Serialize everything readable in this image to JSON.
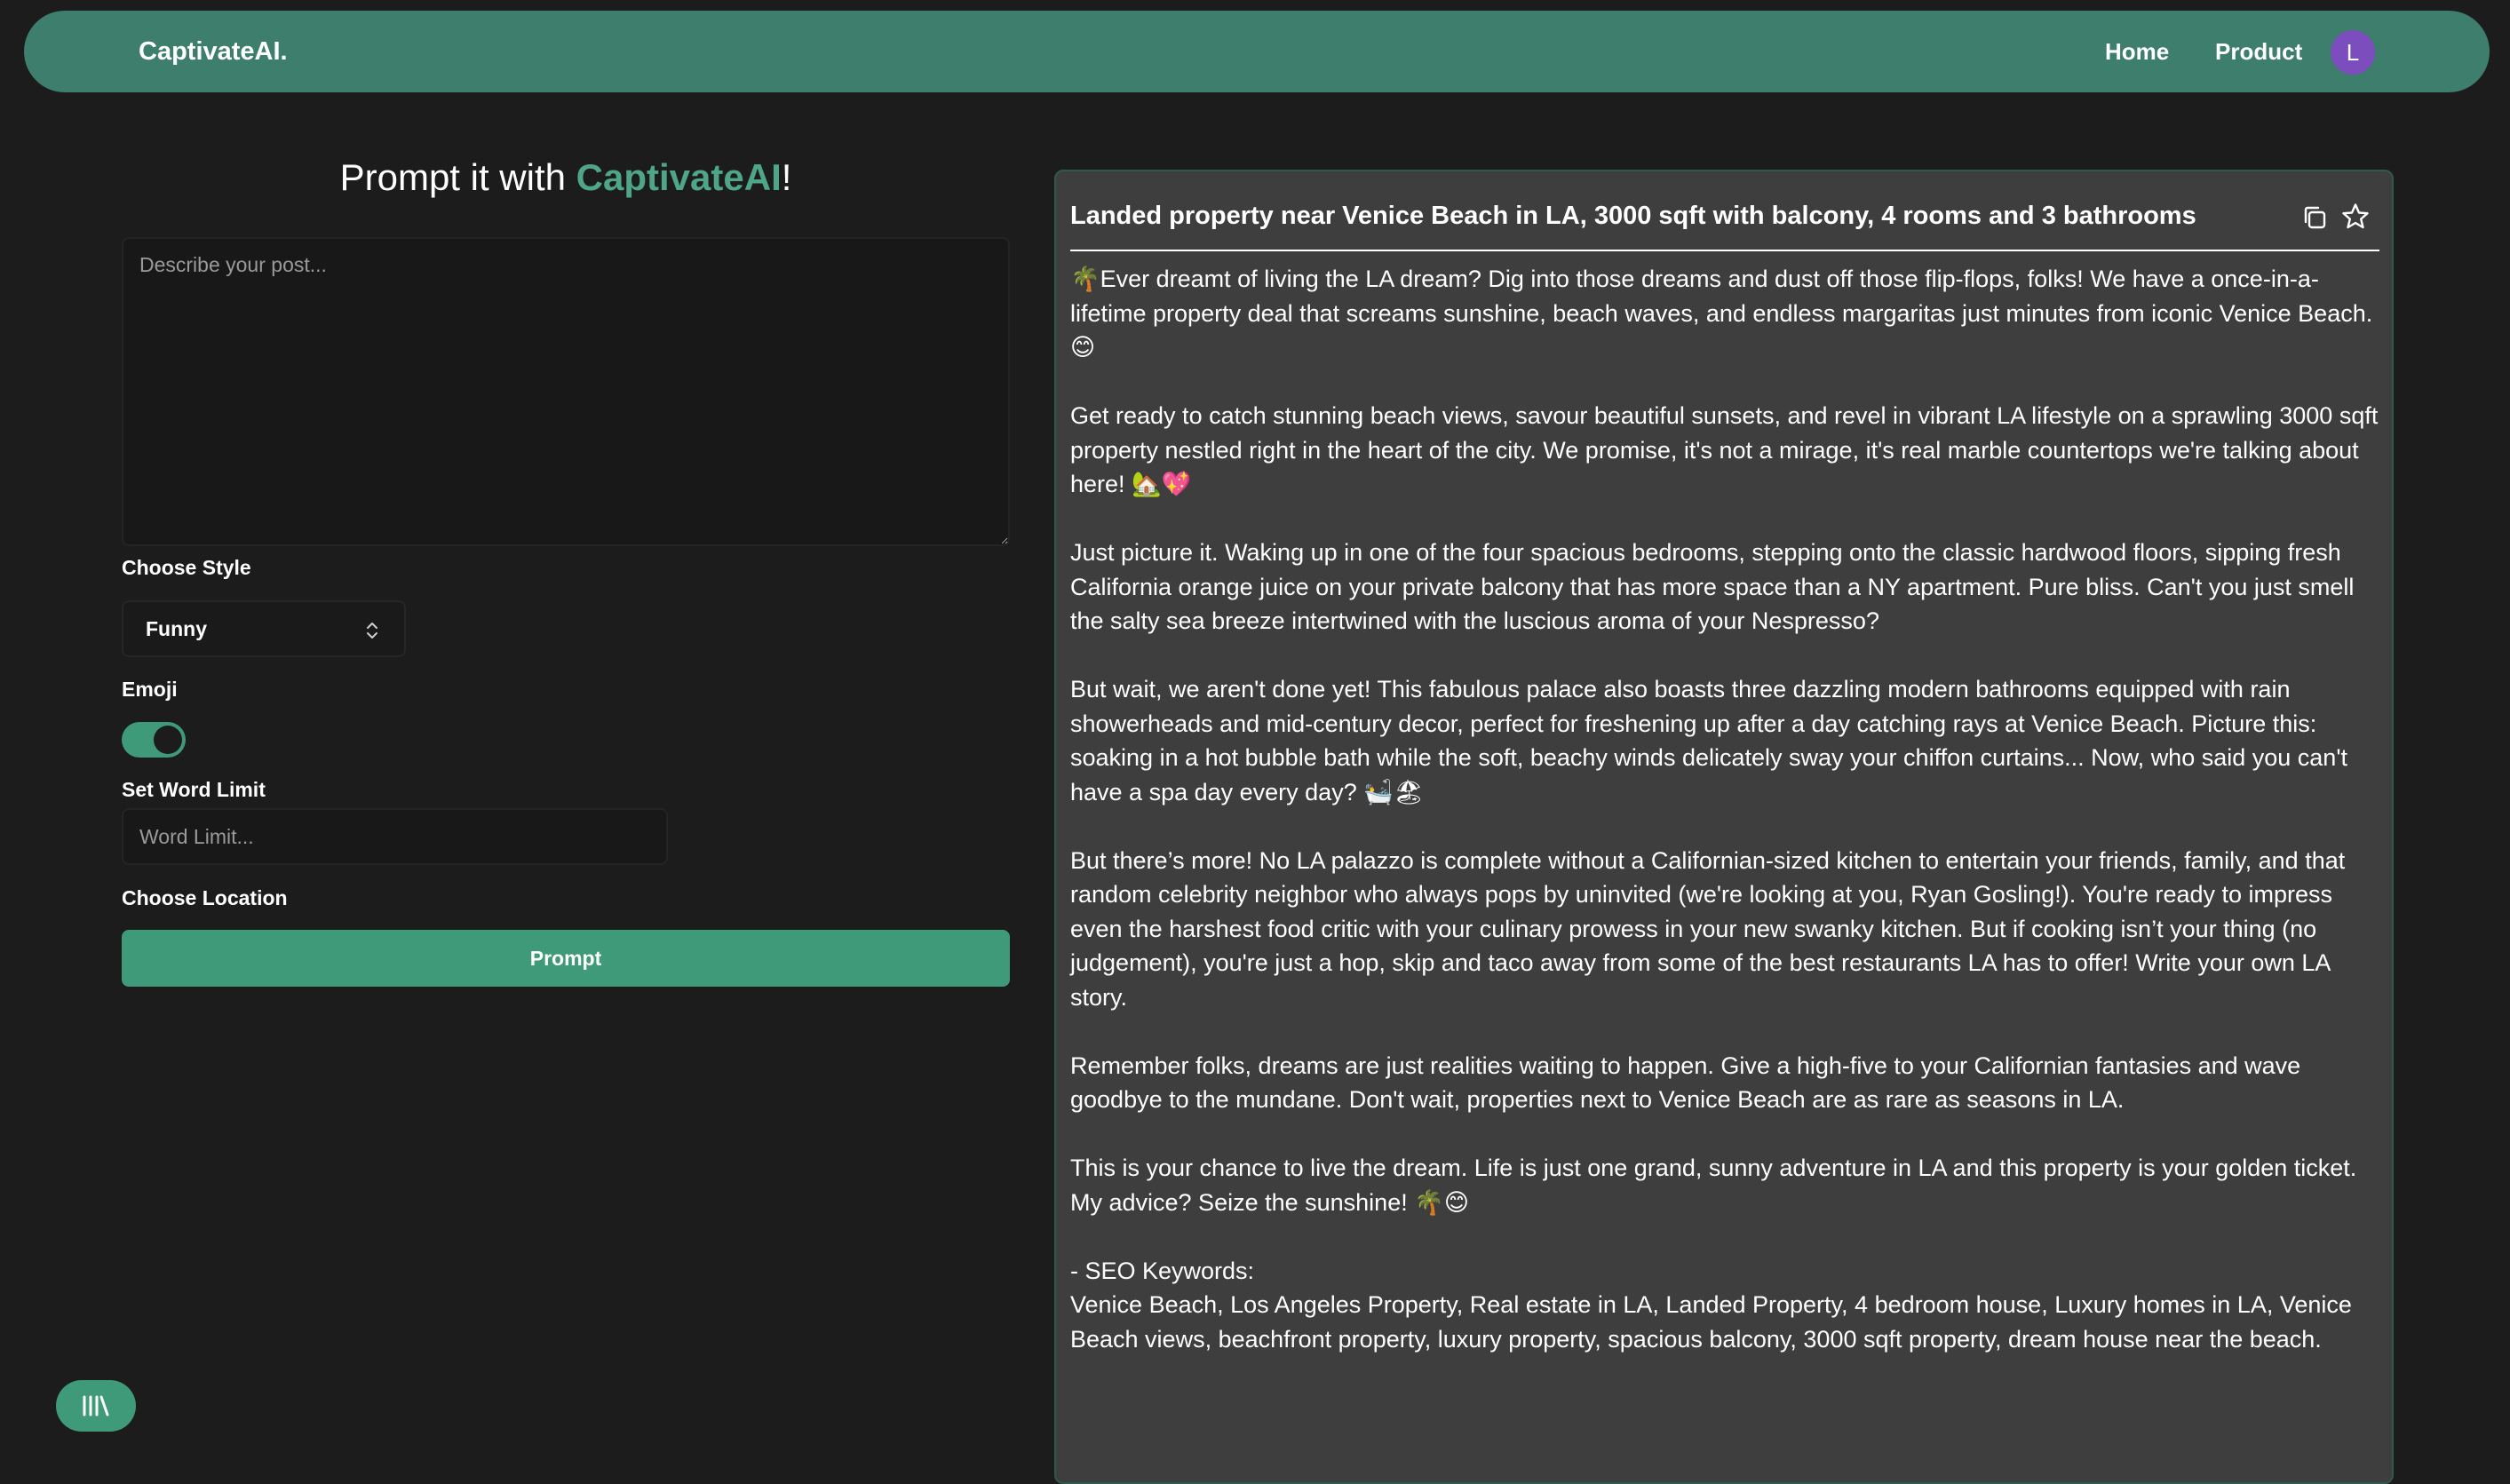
{
  "navbar": {
    "brand": "CaptivateAI.",
    "links": [
      "Home",
      "Product"
    ],
    "avatar_initial": "L",
    "background_color": "#3d7e6c",
    "avatar_color": "#7c4dbd"
  },
  "form": {
    "heading_prefix": "Prompt it with ",
    "heading_brand": "CaptivateAI",
    "heading_suffix": "!",
    "textarea_placeholder": "Describe your post...",
    "style_label": "Choose Style",
    "style_value": "Funny",
    "emoji_label": "Emoji",
    "emoji_enabled": true,
    "word_limit_label": "Set Word Limit",
    "word_limit_placeholder": "Word Limit...",
    "location_label": "Choose Location",
    "prompt_button": "Prompt",
    "accent_color": "#3f9a7a"
  },
  "result": {
    "title": "Landed property near Venice Beach in LA, 3000 sqft with balcony, 4 rooms and 3 bathrooms",
    "paragraphs": [
      "🌴Ever dreamt of living the LA dream? Dig into those dreams and dust off those flip-flops, folks! We have a once-in-a-lifetime property deal that screams sunshine, beach waves, and endless margaritas just minutes from iconic Venice Beach.😊",
      "Get ready to catch stunning beach views, savour beautiful sunsets, and revel in vibrant LA lifestyle on a sprawling 3000 sqft property nestled right in the heart of the city. We promise, it's not a mirage, it's real marble countertops we're talking about here! 🏡💖",
      "Just picture it. Waking up in one of the four spacious bedrooms, stepping onto the classic hardwood floors, sipping fresh California orange juice on your private balcony that has more space than a NY apartment. Pure bliss. Can't you just smell the salty sea breeze intertwined with the luscious aroma of your Nespresso?",
      "But wait, we aren't done yet! This fabulous palace also boasts three dazzling modern bathrooms equipped with rain showerheads and mid-century decor, perfect for freshening up after a day catching rays at Venice Beach. Picture this: soaking in a hot bubble bath while the soft, beachy winds delicately sway your chiffon curtains... Now, who said you can't have a spa day every day? 🛀🏖",
      "But there’s more! No LA palazzo is complete without a Californian-sized kitchen to entertain your friends, family, and that random celebrity neighbor who always pops by uninvited (we're looking at you, Ryan Gosling!). You're ready to impress even the harshest food critic with your culinary prowess in your new swanky kitchen. But if cooking isn’t your thing (no judgement), you're just a hop, skip and taco away from some of the best restaurants LA has to offer! Write your own LA story.",
      "Remember folks, dreams are just realities waiting to happen. Give a high-five to your Californian fantasies and wave goodbye to the mundane. Don't wait, properties next to Venice Beach are as rare as seasons in LA.",
      "This is your chance to live the dream. Life is just one grand, sunny adventure in LA and this property is your golden ticket. My advice? Seize the sunshine! 🌴😊"
    ],
    "seo_heading": "- SEO Keywords:",
    "seo_keywords": "Venice Beach, Los Angeles Property, Real estate in LA, Landed Property, 4 bedroom house, Luxury homes in LA, Venice Beach views, beachfront property, luxury property, spacious balcony, 3000 sqft property, dream house near the beach."
  },
  "icons": {
    "copy": "copy-icon",
    "favorite": "star-icon",
    "library": "library-icon",
    "style_select": "chevron-up-down-icon"
  }
}
